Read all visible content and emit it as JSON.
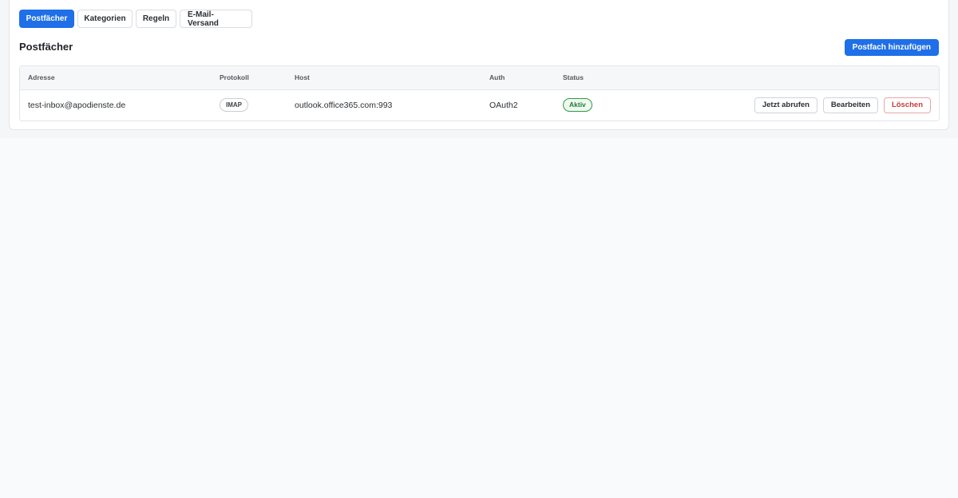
{
  "tabs": [
    {
      "label": "Postfächer",
      "active": true
    },
    {
      "label": "Kategorien",
      "active": false
    },
    {
      "label": "Regeln",
      "active": false
    },
    {
      "label": "E-Mail-Versand",
      "active": false
    }
  ],
  "section": {
    "title": "Postfächer",
    "add_button": "Postfach hinzufügen"
  },
  "table": {
    "headers": {
      "address": "Adresse",
      "protocol": "Protokoll",
      "host": "Host",
      "auth": "Auth",
      "status": "Status"
    },
    "rows": [
      {
        "address": "test-inbox@apodienste.de",
        "protocol": "IMAP",
        "host": "outlook.office365.com:993",
        "auth": "OAuth2",
        "status": "Aktiv",
        "actions": {
          "fetch": "Jetzt abrufen",
          "edit": "Bearbeiten",
          "delete": "Löschen"
        }
      }
    ]
  },
  "colors": {
    "accent": "#1e6fe8",
    "status_active": "#2e9a46",
    "danger": "#c83a3a"
  }
}
